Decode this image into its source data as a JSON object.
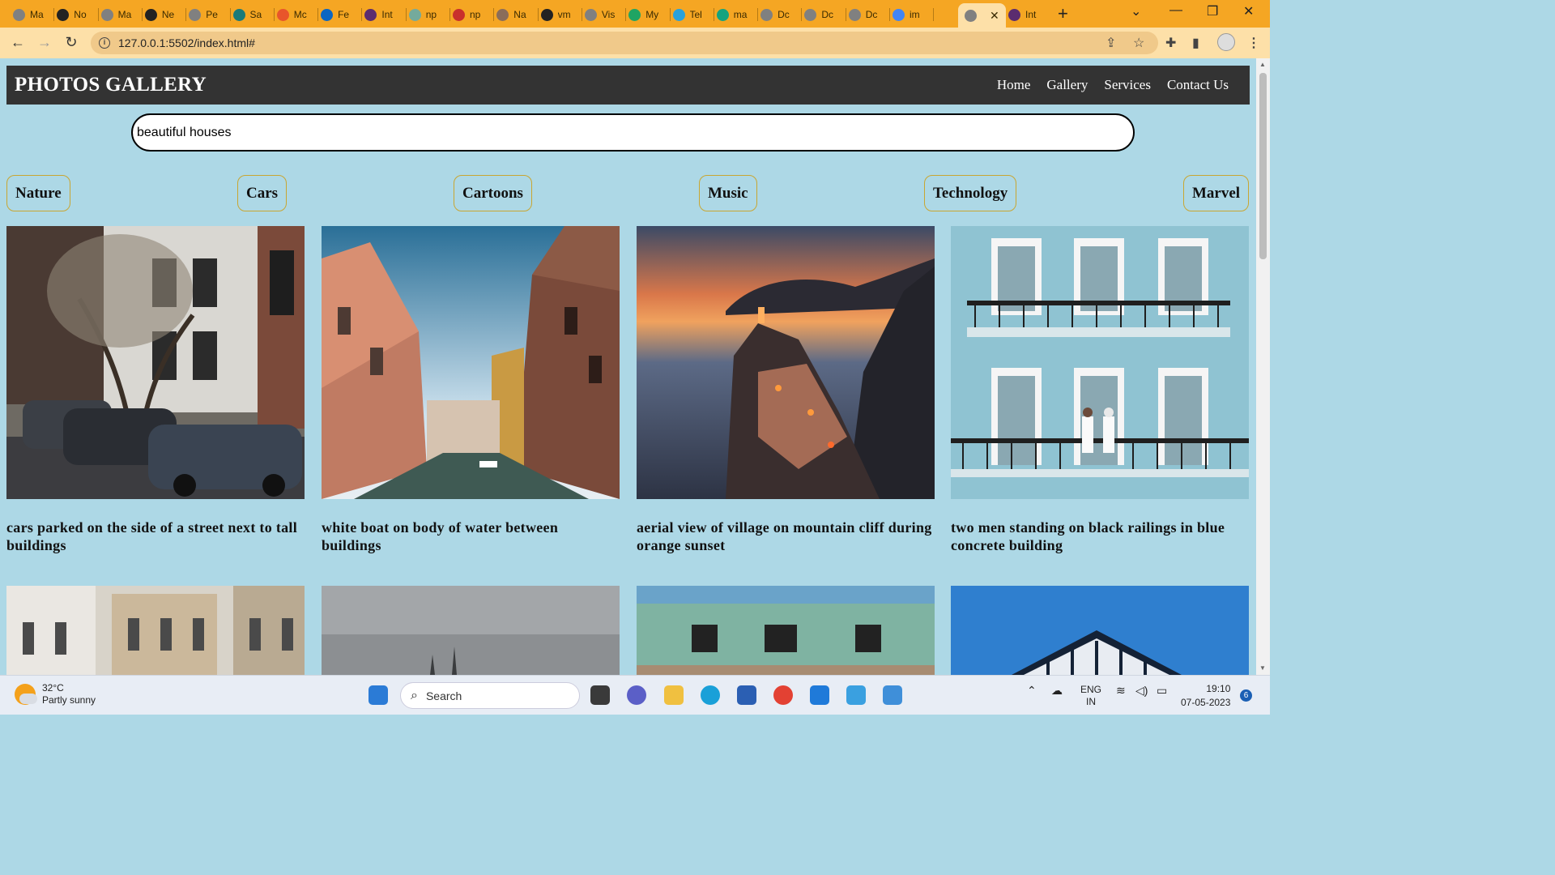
{
  "browser": {
    "tabs": [
      {
        "label": "Ma",
        "color": "#808080"
      },
      {
        "label": "No",
        "color": "#222222"
      },
      {
        "label": "Ma",
        "color": "#808080"
      },
      {
        "label": "Ne",
        "color": "#222222"
      },
      {
        "label": "Pe",
        "color": "#808080"
      },
      {
        "label": "Sa",
        "color": "#1b7a78"
      },
      {
        "label": "Mc",
        "color": "#e8552b"
      },
      {
        "label": "Fe",
        "color": "#0a66c2"
      },
      {
        "label": "Int",
        "color": "#5b2c6f"
      },
      {
        "label": "np",
        "color": "#74aa9c"
      },
      {
        "label": "np",
        "color": "#c9302c"
      },
      {
        "label": "Na",
        "color": "#8a6d5a"
      },
      {
        "label": "vm",
        "color": "#222222"
      },
      {
        "label": "Vis",
        "color": "#808080"
      },
      {
        "label": "My",
        "color": "#1fa463"
      },
      {
        "label": "Tel",
        "color": "#2aa1da"
      },
      {
        "label": "ma",
        "color": "#14a37f"
      },
      {
        "label": "Dc",
        "color": "#808080"
      },
      {
        "label": "Dc",
        "color": "#808080"
      },
      {
        "label": "Dc",
        "color": "#808080"
      },
      {
        "label": "im",
        "color": "#4285f4"
      }
    ],
    "active_tab_color": "#808080",
    "last_tab": {
      "label": "Int",
      "color": "#5b2c6f"
    },
    "url": "127.0.0.1:5502/index.html#"
  },
  "page": {
    "brand": "PHOTOS GALLERY",
    "nav": [
      "Home",
      "Gallery",
      "Services",
      "Contact Us"
    ],
    "search_value": "beautiful houses",
    "categories": [
      "Nature",
      "Cars",
      "Cartoons",
      "Music",
      "Technology",
      "Marvel"
    ],
    "photos": [
      {
        "caption": "cars parked on the side of a street next to tall buildings"
      },
      {
        "caption": "white boat on body of water between buildings"
      },
      {
        "caption": "aerial view of village on mountain cliff during orange sunset"
      },
      {
        "caption": "two men standing on black railings in blue concrete building"
      }
    ]
  },
  "colors": {
    "page_bg": "#add8e6",
    "navbar_bg": "#333333",
    "category_border": "#c8a632",
    "tab_strip": "#f5a623"
  },
  "taskbar": {
    "temp": "32°C",
    "weather": "Partly sunny",
    "search_label": "Search",
    "lang": "ENG",
    "region": "IN",
    "time": "19:10",
    "date": "07-05-2023",
    "notifications": "6"
  }
}
